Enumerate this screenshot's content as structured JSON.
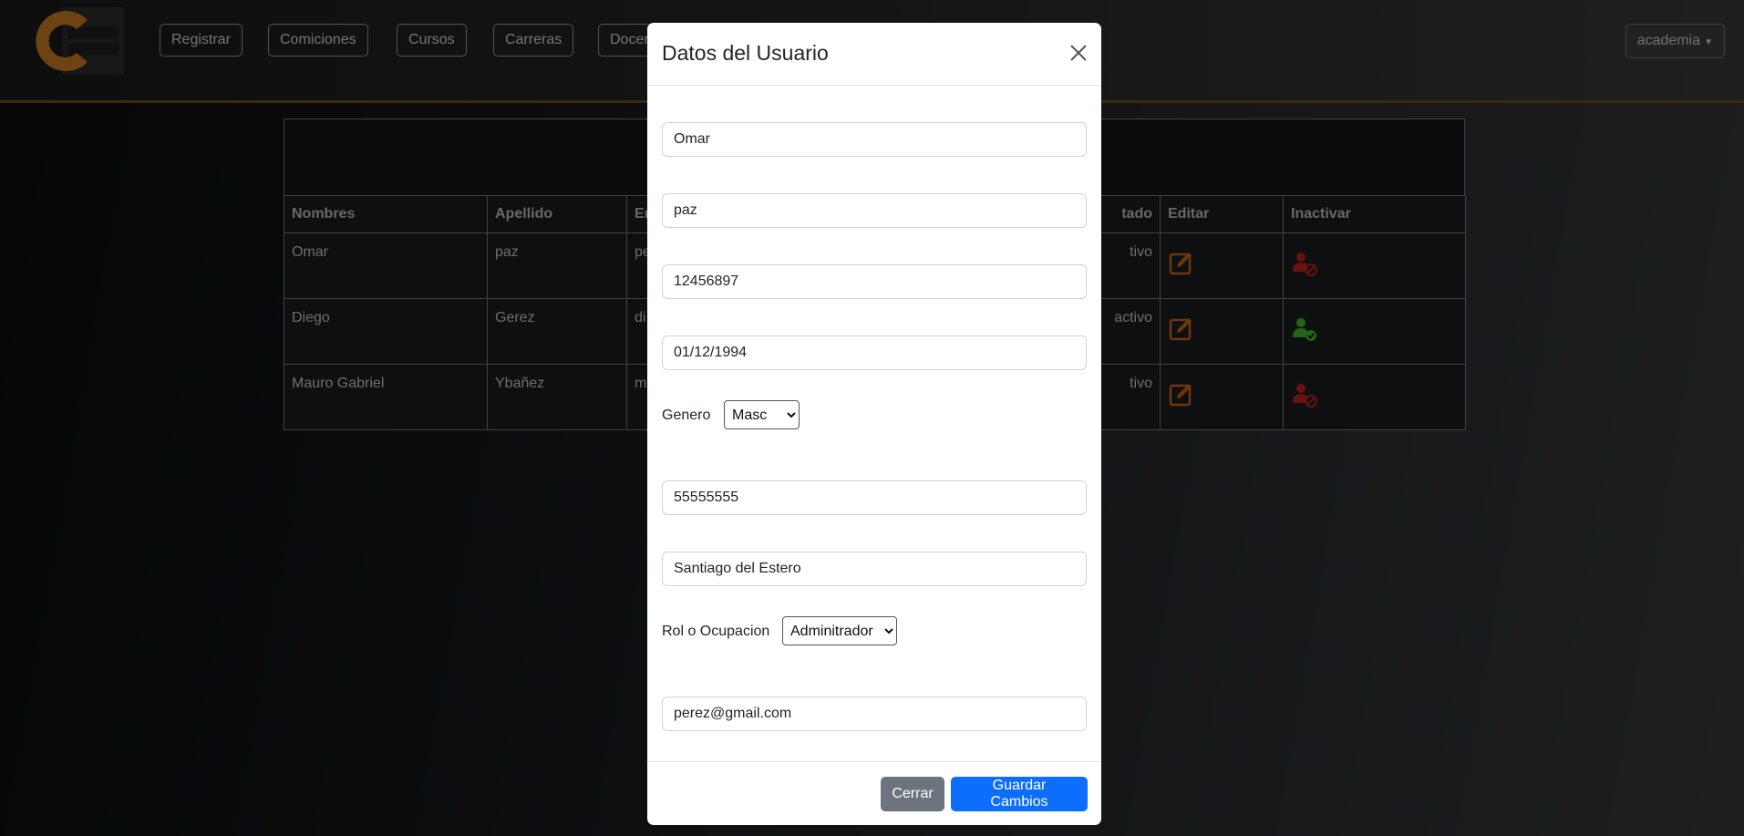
{
  "nav": {
    "items": [
      "Registrar",
      "Comiciones",
      "Cursos",
      "Carreras",
      "Docentes"
    ],
    "user_menu": "academia"
  },
  "table": {
    "headers": [
      "Nombres",
      "Apellido",
      "Email",
      "Estado",
      "Editar",
      "Inactivar"
    ],
    "header_visible": [
      "Nombres",
      "Apellido",
      "Em",
      "tado",
      "Editar",
      "Inactivar"
    ],
    "rows": [
      {
        "nombre": "Omar",
        "apellido": "paz",
        "email_partial": "pe",
        "estado_partial": "tivo",
        "action": "inactivate"
      },
      {
        "nombre": "Diego",
        "apellido": "Gerez",
        "email_partial": "di",
        "estado_partial": "activo",
        "action": "activate"
      },
      {
        "nombre": "Mauro Gabriel",
        "apellido": "Ybañez",
        "email_partial": "ma",
        "estado_partial": "tivo",
        "action": "inactivate"
      }
    ]
  },
  "modal": {
    "title": "Datos del Usuario",
    "nombre": "Omar",
    "apellido": "paz",
    "dni": "12456897",
    "fecha_nacimiento": "01/12/1994",
    "genero_label": "Genero",
    "genero_value": "Masc",
    "telefono": "55555555",
    "direccion": "Santiago del Estero",
    "rol_label": "Rol o Ocupacion",
    "rol_value": "Adminitrador",
    "email": "perez@gmail.com",
    "close_label": "Cerrar",
    "save_label": "Guardar Cambios"
  },
  "colors": {
    "edit_icon": "#c8651b",
    "inactivate_icon": "#c0211f",
    "activate_icon": "#3fb62c",
    "primary": "#0d6efd",
    "secondary": "#6c757d",
    "logo": "#c97a24"
  }
}
